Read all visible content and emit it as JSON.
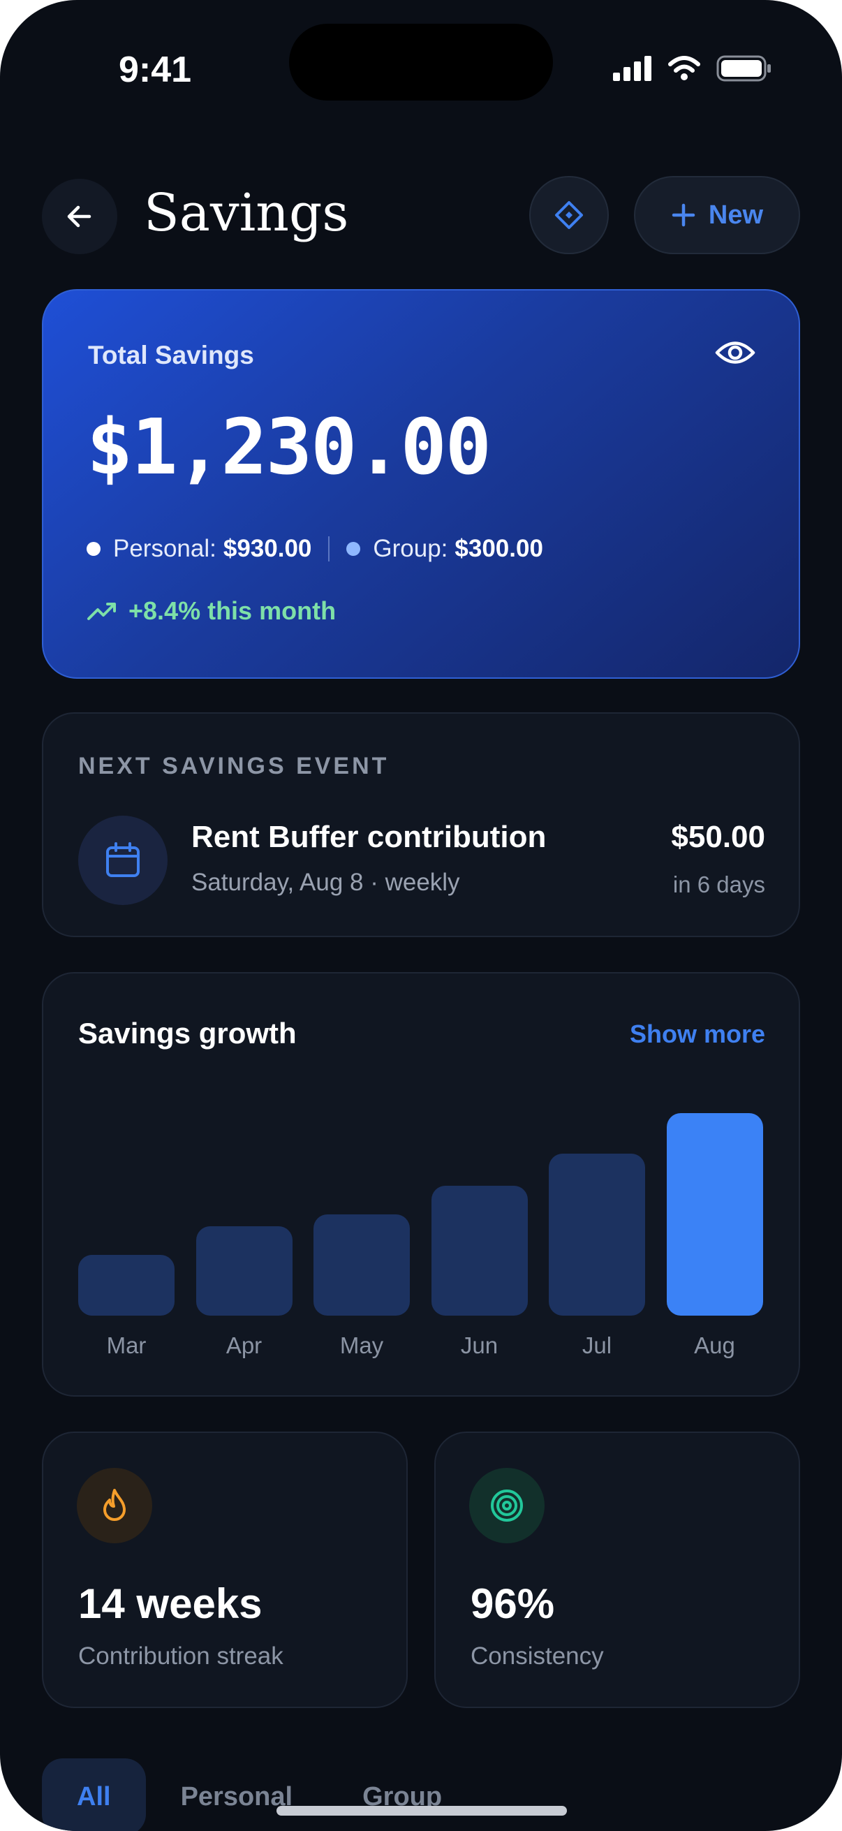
{
  "status_bar": {
    "time": "9:41"
  },
  "header": {
    "title": "Savings",
    "new_label": "New"
  },
  "hero": {
    "label": "Total Savings",
    "amount": "$1,230.00",
    "personal_label": "Personal:",
    "personal_value": "$930.00",
    "group_label": "Group:",
    "group_value": "$300.00",
    "trend": "+8.4% this month"
  },
  "next_event": {
    "eyebrow": "NEXT SAVINGS EVENT",
    "title": "Rent Buffer contribution",
    "subtitle": "Saturday, Aug 8 · weekly",
    "amount": "$50.00",
    "when": "in 6 days"
  },
  "growth": {
    "title": "Savings growth",
    "show_more": "Show more"
  },
  "chart_data": {
    "type": "bar",
    "categories": [
      "Mar",
      "Apr",
      "May",
      "Jun",
      "Jul",
      "Aug"
    ],
    "values": [
      30,
      44,
      50,
      64,
      80,
      100
    ],
    "highlight_index": 5,
    "ylim": [
      0,
      100
    ],
    "grid": false
  },
  "stats": [
    {
      "value": "14 weeks",
      "label": "Contribution streak",
      "icon": "flame-icon"
    },
    {
      "value": "96%",
      "label": "Consistency",
      "icon": "target-icon"
    }
  ],
  "tabs": [
    {
      "label": "All",
      "active": true
    },
    {
      "label": "Personal",
      "active": false
    },
    {
      "label": "Group",
      "active": false
    }
  ],
  "colors": {
    "accent": "#3f80f0",
    "bar_muted": "#1c3260",
    "bar_active": "#3b82f6",
    "trend_green": "#7ee0a8"
  }
}
